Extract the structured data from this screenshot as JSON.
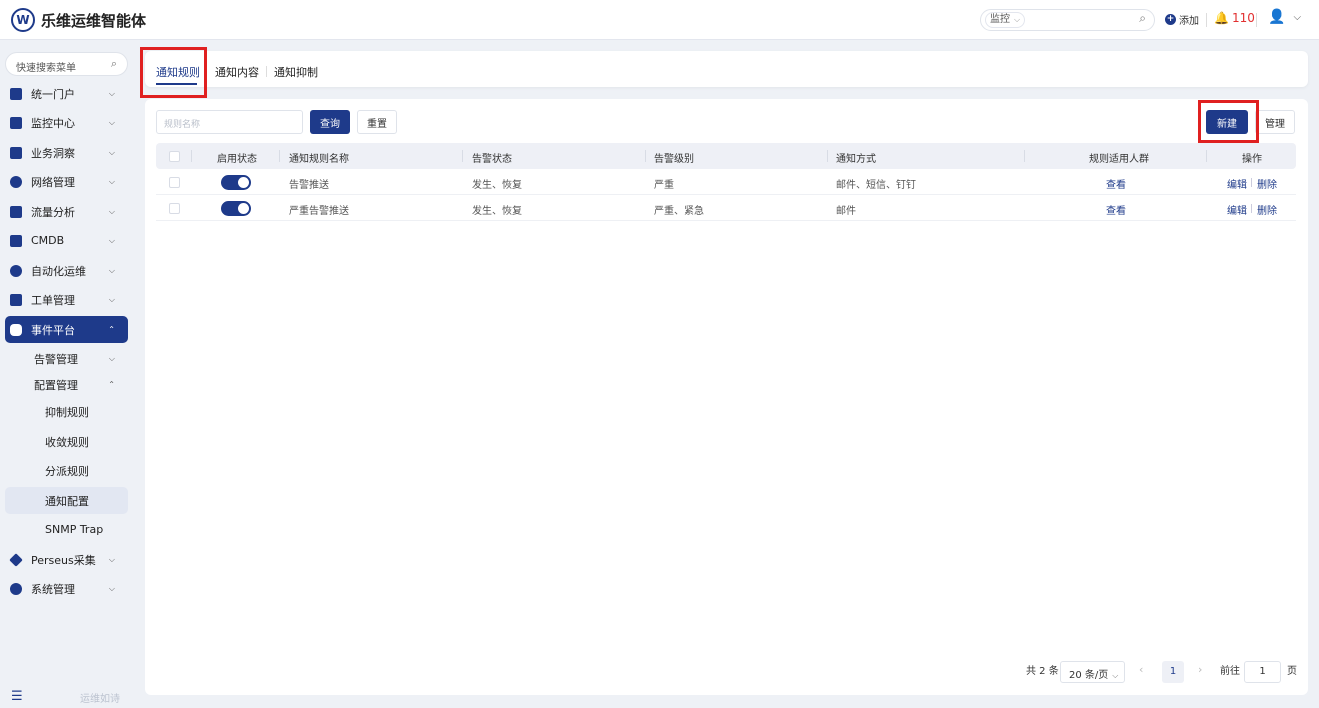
{
  "header": {
    "logo": "W",
    "app_title": "乐维运维智能体",
    "search_scope": "监控",
    "add_label": "添加",
    "alert_count": "110"
  },
  "sidebar": {
    "search_placeholder": "快速搜索菜单",
    "menu": [
      {
        "label": "统一门户",
        "icon": "home-icon"
      },
      {
        "label": "监控中心",
        "icon": "monitor-icon"
      },
      {
        "label": "业务洞察",
        "icon": "insight-icon"
      },
      {
        "label": "网络管理",
        "icon": "globe-icon"
      },
      {
        "label": "流量分析",
        "icon": "chart-icon"
      },
      {
        "label": "CMDB",
        "icon": "cube-icon"
      },
      {
        "label": "自动化运维",
        "icon": "automation-icon"
      },
      {
        "label": "工单管理",
        "icon": "ticket-icon"
      },
      {
        "label": "事件平台",
        "icon": "event-icon"
      },
      {
        "label": "Perseus采集",
        "icon": "diamond-icon"
      },
      {
        "label": "系统管理",
        "icon": "gear-icon"
      }
    ],
    "sub_menu": {
      "alarm_mgmt": "告警管理",
      "config_mgmt": "配置管理",
      "leaves": [
        "抑制规则",
        "收敛规则",
        "分派规则",
        "通知配置",
        "SNMP Trap"
      ]
    },
    "footer": "运维如诗"
  },
  "tabs": [
    "通知规则",
    "通知内容",
    "通知抑制"
  ],
  "toolbar": {
    "rule_name_placeholder": "规则名称",
    "query": "查询",
    "reset": "重置",
    "new": "新建",
    "manage": "管理"
  },
  "table": {
    "columns": [
      "启用状态",
      "通知规则名称",
      "告警状态",
      "告警级别",
      "通知方式",
      "规则适用人群",
      "操作"
    ],
    "rows": [
      {
        "enabled": true,
        "name": "告警推送",
        "alert_status": "发生、恢复",
        "alert_level": "严重",
        "notify_method": "邮件、短信、钉钉",
        "audience": "查看",
        "edit": "编辑",
        "delete": "删除"
      },
      {
        "enabled": true,
        "name": "严重告警推送",
        "alert_status": "发生、恢复",
        "alert_level": "严重、紧急",
        "notify_method": "邮件",
        "audience": "查看",
        "edit": "编辑",
        "delete": "删除"
      }
    ]
  },
  "pagination": {
    "total": "共 2 条",
    "page_size": "20 条/页",
    "current_page": "1",
    "goto_prefix": "前往",
    "goto_value": "1",
    "goto_suffix": "页"
  },
  "colors": {
    "primary": "#1e3a8a",
    "alert": "#e23030",
    "highlight": "#e02020"
  }
}
